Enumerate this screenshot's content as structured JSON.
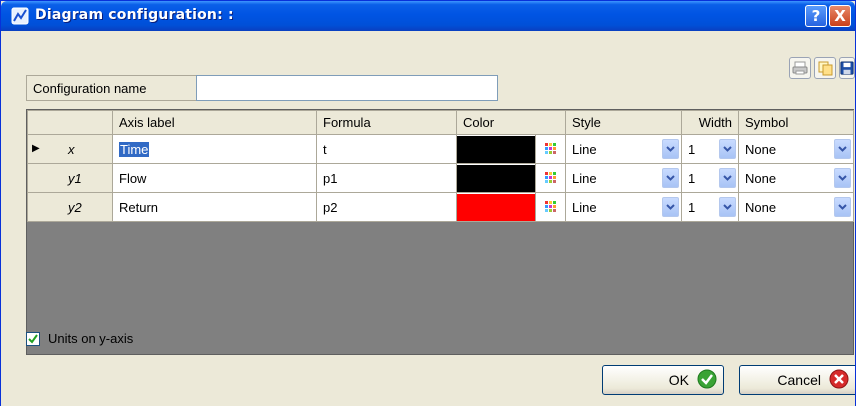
{
  "window": {
    "title": "Diagram configuration: :",
    "help_label": "?",
    "close_label": "X"
  },
  "toolbar": {
    "icons": [
      "print-icon",
      "copy-icon",
      "save-icon"
    ]
  },
  "config": {
    "name_label": "Configuration name",
    "name_value": ""
  },
  "grid": {
    "headers": [
      "Axis label",
      "Formula",
      "Color",
      "Style",
      "Width",
      "Symbol"
    ],
    "rows": [
      {
        "name": "x",
        "label": "Time",
        "formula": "t",
        "color": "#000000",
        "style": "Line",
        "width": "1",
        "symbol": "None",
        "selected": true
      },
      {
        "name": "y1",
        "label": "Flow",
        "formula": "p1",
        "color": "#000000",
        "style": "Line",
        "width": "1",
        "symbol": "None",
        "selected": false
      },
      {
        "name": "y2",
        "label": "Return",
        "formula": "p2",
        "color": "#ff0000",
        "style": "Line",
        "width": "1",
        "symbol": "None",
        "selected": false
      }
    ]
  },
  "options": {
    "units_label": "Units on y-axis",
    "units_checked": true
  },
  "buttons": {
    "ok": "OK",
    "cancel": "Cancel"
  },
  "colors": {
    "titlebar": "#0054e3",
    "dialog_bg": "#ece9d8",
    "grid_empty": "#808080",
    "ok_icon": "#3aa335",
    "cancel_icon": "#d62b2b"
  }
}
